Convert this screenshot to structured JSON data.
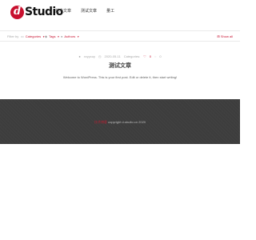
{
  "header": {
    "logo_letter": "d",
    "logo_text": "Studio",
    "nav": [
      "技术文章",
      "测试文章",
      "量工"
    ]
  },
  "filter": {
    "label": "Filter by",
    "categories": "Categories",
    "tags": "Tags",
    "authors": "Authors",
    "show_all": "Show all"
  },
  "post": {
    "author": "xxyycuy",
    "date": "2020-05-11",
    "category_prefix": "Categories:",
    "likes": "0",
    "comments": "0",
    "title": "测试文章",
    "excerpt": "Welcome to WordPress. This is your first post. Edit or delete it, then start writing!"
  },
  "footer": {
    "brand": "技术博客",
    "copyright": "copyright d-studio.cn 2020"
  },
  "colors": {
    "accent": "#c8102e",
    "footer_bg": "#3d3d3d"
  }
}
